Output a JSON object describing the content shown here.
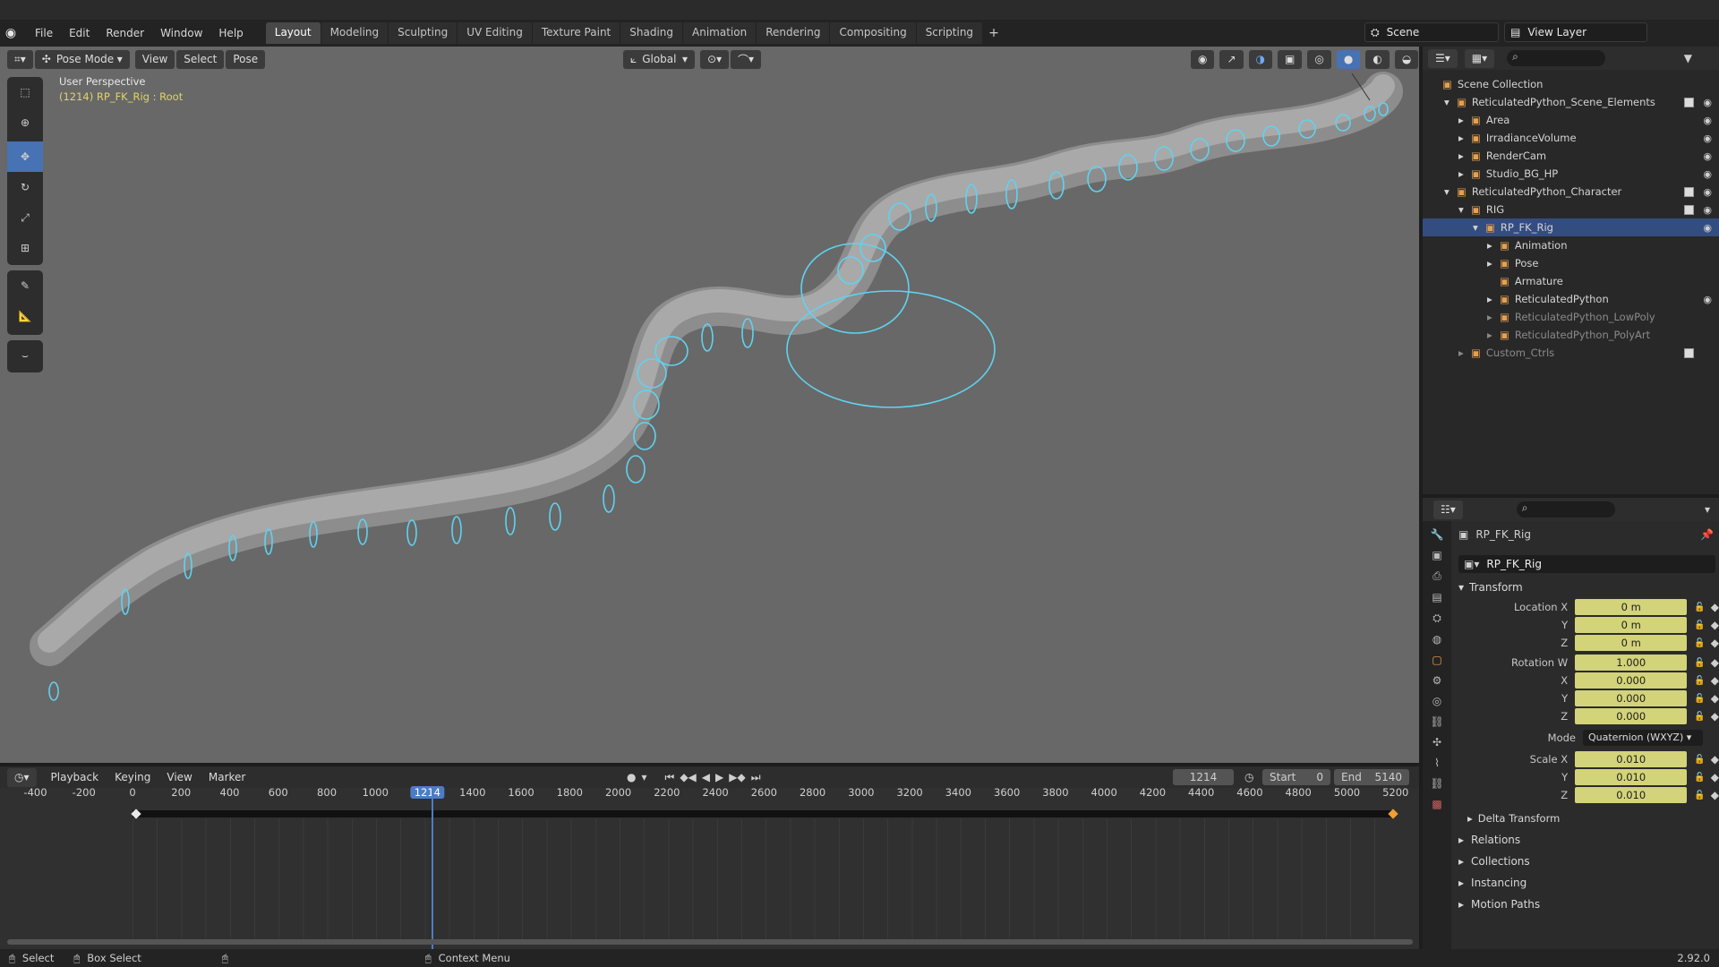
{
  "menu": [
    "File",
    "Edit",
    "Render",
    "Window",
    "Help"
  ],
  "workspaces": [
    "Layout",
    "Modeling",
    "Sculpting",
    "UV Editing",
    "Texture Paint",
    "Shading",
    "Animation",
    "Rendering",
    "Compositing",
    "Scripting"
  ],
  "top_right": {
    "scene": "Scene",
    "view_layer": "View Layer"
  },
  "viewport": {
    "mode": "Pose Mode",
    "menu": [
      "View",
      "Select",
      "Pose"
    ],
    "transform_orientation": "Global",
    "overlay_title": "User Perspective",
    "overlay_sub": "(1214) RP_FK_Rig : Root"
  },
  "outliner": {
    "rows": [
      {
        "label": "Scene Collection",
        "indent": 0,
        "arrow": "",
        "eye": false,
        "chk": false
      },
      {
        "label": "ReticulatedPython_Scene_Elements",
        "indent": 1,
        "arrow": "▾",
        "eye": true,
        "chk": true
      },
      {
        "label": "Area",
        "indent": 2,
        "arrow": "▸",
        "eye": true,
        "chk": false
      },
      {
        "label": "IrradianceVolume",
        "indent": 2,
        "arrow": "▸",
        "eye": true,
        "chk": false
      },
      {
        "label": "RenderCam",
        "indent": 2,
        "arrow": "▸",
        "eye": true,
        "chk": false
      },
      {
        "label": "Studio_BG_HP",
        "indent": 2,
        "arrow": "▸",
        "eye": true,
        "chk": false
      },
      {
        "label": "ReticulatedPython_Character",
        "indent": 1,
        "arrow": "▾",
        "eye": true,
        "chk": true
      },
      {
        "label": "RIG",
        "indent": 2,
        "arrow": "▾",
        "eye": true,
        "chk": true
      },
      {
        "label": "RP_FK_Rig",
        "indent": 3,
        "arrow": "▾",
        "eye": true,
        "chk": false,
        "sel": true
      },
      {
        "label": "Animation",
        "indent": 4,
        "arrow": "▸",
        "eye": false,
        "chk": false
      },
      {
        "label": "Pose",
        "indent": 4,
        "arrow": "▸",
        "eye": false,
        "chk": false
      },
      {
        "label": "Armature",
        "indent": 4,
        "arrow": "",
        "eye": false,
        "chk": false
      },
      {
        "label": "ReticulatedPython",
        "indent": 4,
        "arrow": "▸",
        "eye": true,
        "chk": false
      },
      {
        "label": "ReticulatedPython_LowPoly",
        "indent": 4,
        "arrow": "▸",
        "eye": false,
        "chk": false,
        "dim": true
      },
      {
        "label": "ReticulatedPython_PolyArt",
        "indent": 4,
        "arrow": "▸",
        "eye": false,
        "chk": false,
        "dim": true
      },
      {
        "label": "Custom_Ctrls",
        "indent": 2,
        "arrow": "▸",
        "eye": false,
        "chk": true,
        "dim": true
      }
    ]
  },
  "properties": {
    "object_name": "RP_FK_Rig",
    "name_field": "RP_FK_Rig",
    "transform_title": "Transform",
    "rows": [
      {
        "label": "Location X",
        "value": "0 m"
      },
      {
        "label": "Y",
        "value": "0 m"
      },
      {
        "label": "Z",
        "value": "0 m"
      },
      {
        "label": "Rotation W",
        "value": "1.000"
      },
      {
        "label": "X",
        "value": "0.000"
      },
      {
        "label": "Y",
        "value": "0.000"
      },
      {
        "label": "Z",
        "value": "0.000"
      }
    ],
    "mode_label": "Mode",
    "mode_value": "Quaternion (WXYZ)",
    "scale_rows": [
      {
        "label": "Scale X",
        "value": "0.010"
      },
      {
        "label": "Y",
        "value": "0.010"
      },
      {
        "label": "Z",
        "value": "0.010"
      }
    ],
    "delta": "Delta Transform",
    "sections": [
      "Relations",
      "Collections",
      "Instancing",
      "Motion Paths"
    ]
  },
  "timeline": {
    "menu": [
      "Playback",
      "Keying",
      "View",
      "Marker"
    ],
    "current_frame": "1214",
    "start_label": "Start",
    "start": "0",
    "end_label": "End",
    "end": "5140",
    "ticks": [
      "-400",
      "-200",
      "0",
      "200",
      "400",
      "600",
      "800",
      "1000",
      "1214",
      "1400",
      "1600",
      "1800",
      "2000",
      "2200",
      "2400",
      "2600",
      "2800",
      "3000",
      "3200",
      "3400",
      "3600",
      "3800",
      "4000",
      "4200",
      "4400",
      "4600",
      "4800",
      "5000",
      "5200"
    ]
  },
  "status": {
    "select": "Select",
    "box_select": "Box Select",
    "context_menu": "Context Menu",
    "version": "2.92.0"
  }
}
